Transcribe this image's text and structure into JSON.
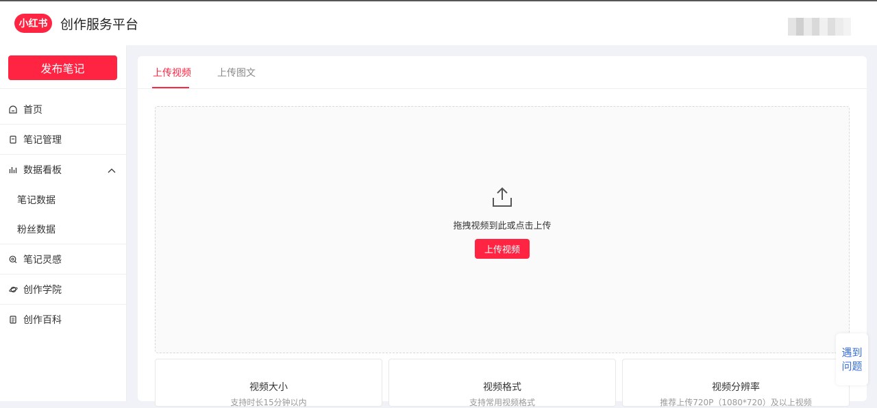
{
  "header": {
    "logo_text": "小红书",
    "platform_title": "创作服务平台"
  },
  "sidebar": {
    "publish_label": "发布笔记",
    "items": [
      {
        "label": "首页",
        "icon": "home-icon"
      },
      {
        "label": "笔记管理",
        "icon": "note-icon"
      },
      {
        "label": "数据看板",
        "icon": "chart-icon",
        "expanded": true
      },
      {
        "label": "笔记数据"
      },
      {
        "label": "粉丝数据"
      },
      {
        "label": "笔记灵感",
        "icon": "inspiration-icon"
      },
      {
        "label": "创作学院",
        "icon": "planet-icon"
      },
      {
        "label": "创作百科",
        "icon": "doc-icon"
      }
    ]
  },
  "main": {
    "tabs": [
      {
        "label": "上传视频",
        "active": true
      },
      {
        "label": "上传图文",
        "active": false
      }
    ],
    "dropzone": {
      "hint": "拖拽视频到此或点击上传",
      "button_label": "上传视频"
    },
    "info_cards": [
      {
        "title": "视频大小",
        "desc": "支持时长15分钟以内"
      },
      {
        "title": "视频格式",
        "desc": "支持常用视频格式"
      },
      {
        "title": "视频分辨率",
        "desc": "推荐上传720P（1080*720）及以上视频"
      }
    ]
  },
  "help": {
    "line1": "遇到",
    "line2": "问题"
  },
  "colors": {
    "brand": "#ff2442",
    "link": "#3a6fd8"
  }
}
